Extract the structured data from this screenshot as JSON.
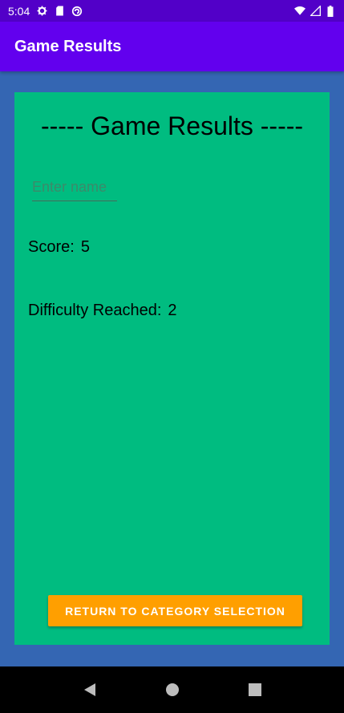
{
  "status_bar": {
    "time": "5:04",
    "left_icons": [
      "gear-icon",
      "sd-card-icon",
      "sync-icon"
    ],
    "right_icons": [
      "wifi-icon",
      "signal-icon",
      "battery-icon"
    ]
  },
  "app_bar": {
    "title": "Game Results"
  },
  "card": {
    "heading": "----- Game Results -----",
    "name_input": {
      "placeholder": "Enter name",
      "value": ""
    },
    "score": {
      "label": "Score:",
      "value": "5"
    },
    "difficulty": {
      "label": "Difficulty Reached:",
      "value": "2"
    },
    "return_button": {
      "label": "RETURN TO CATEGORY SELECTION"
    }
  },
  "nav_bar": {
    "buttons": [
      "back-icon",
      "home-icon",
      "recents-icon"
    ]
  },
  "colors": {
    "status_bar": "#5200c8",
    "app_bar": "#6200ee",
    "background": "#3466b3",
    "card": "#00bc80",
    "button": "#ff9f00"
  }
}
